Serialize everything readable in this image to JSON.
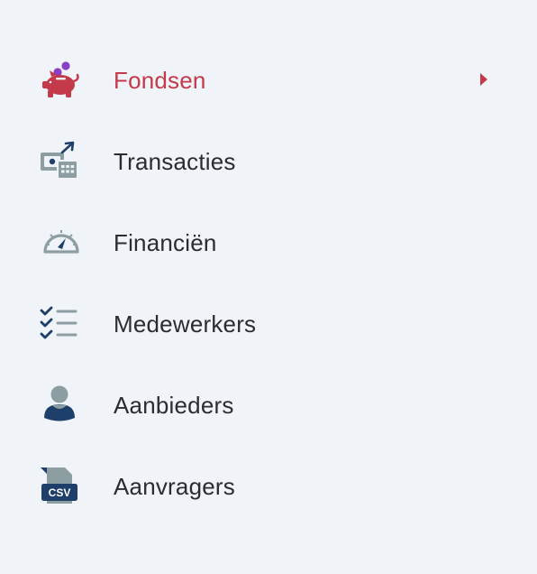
{
  "theme": {
    "background": "#f0f3f7",
    "accent": "#c53a4b",
    "text": "#2a2c30",
    "icon_navy": "#1f3f6b",
    "icon_gray": "#8d9ea3",
    "icon_purple": "#8a3fc6"
  },
  "menu": {
    "items": [
      {
        "label": "Fondsen",
        "icon": "piggy-bank-icon",
        "active": true
      },
      {
        "label": "Transacties",
        "icon": "transactions-icon",
        "active": false
      },
      {
        "label": "Financiën",
        "icon": "speedometer-icon",
        "active": false
      },
      {
        "label": "Medewerkers",
        "icon": "checklist-icon",
        "active": false
      },
      {
        "label": "Aanbieders",
        "icon": "user-icon",
        "active": false
      },
      {
        "label": "Aanvragers",
        "icon": "csv-file-icon",
        "active": false
      }
    ],
    "csv_badge": "CSV"
  }
}
